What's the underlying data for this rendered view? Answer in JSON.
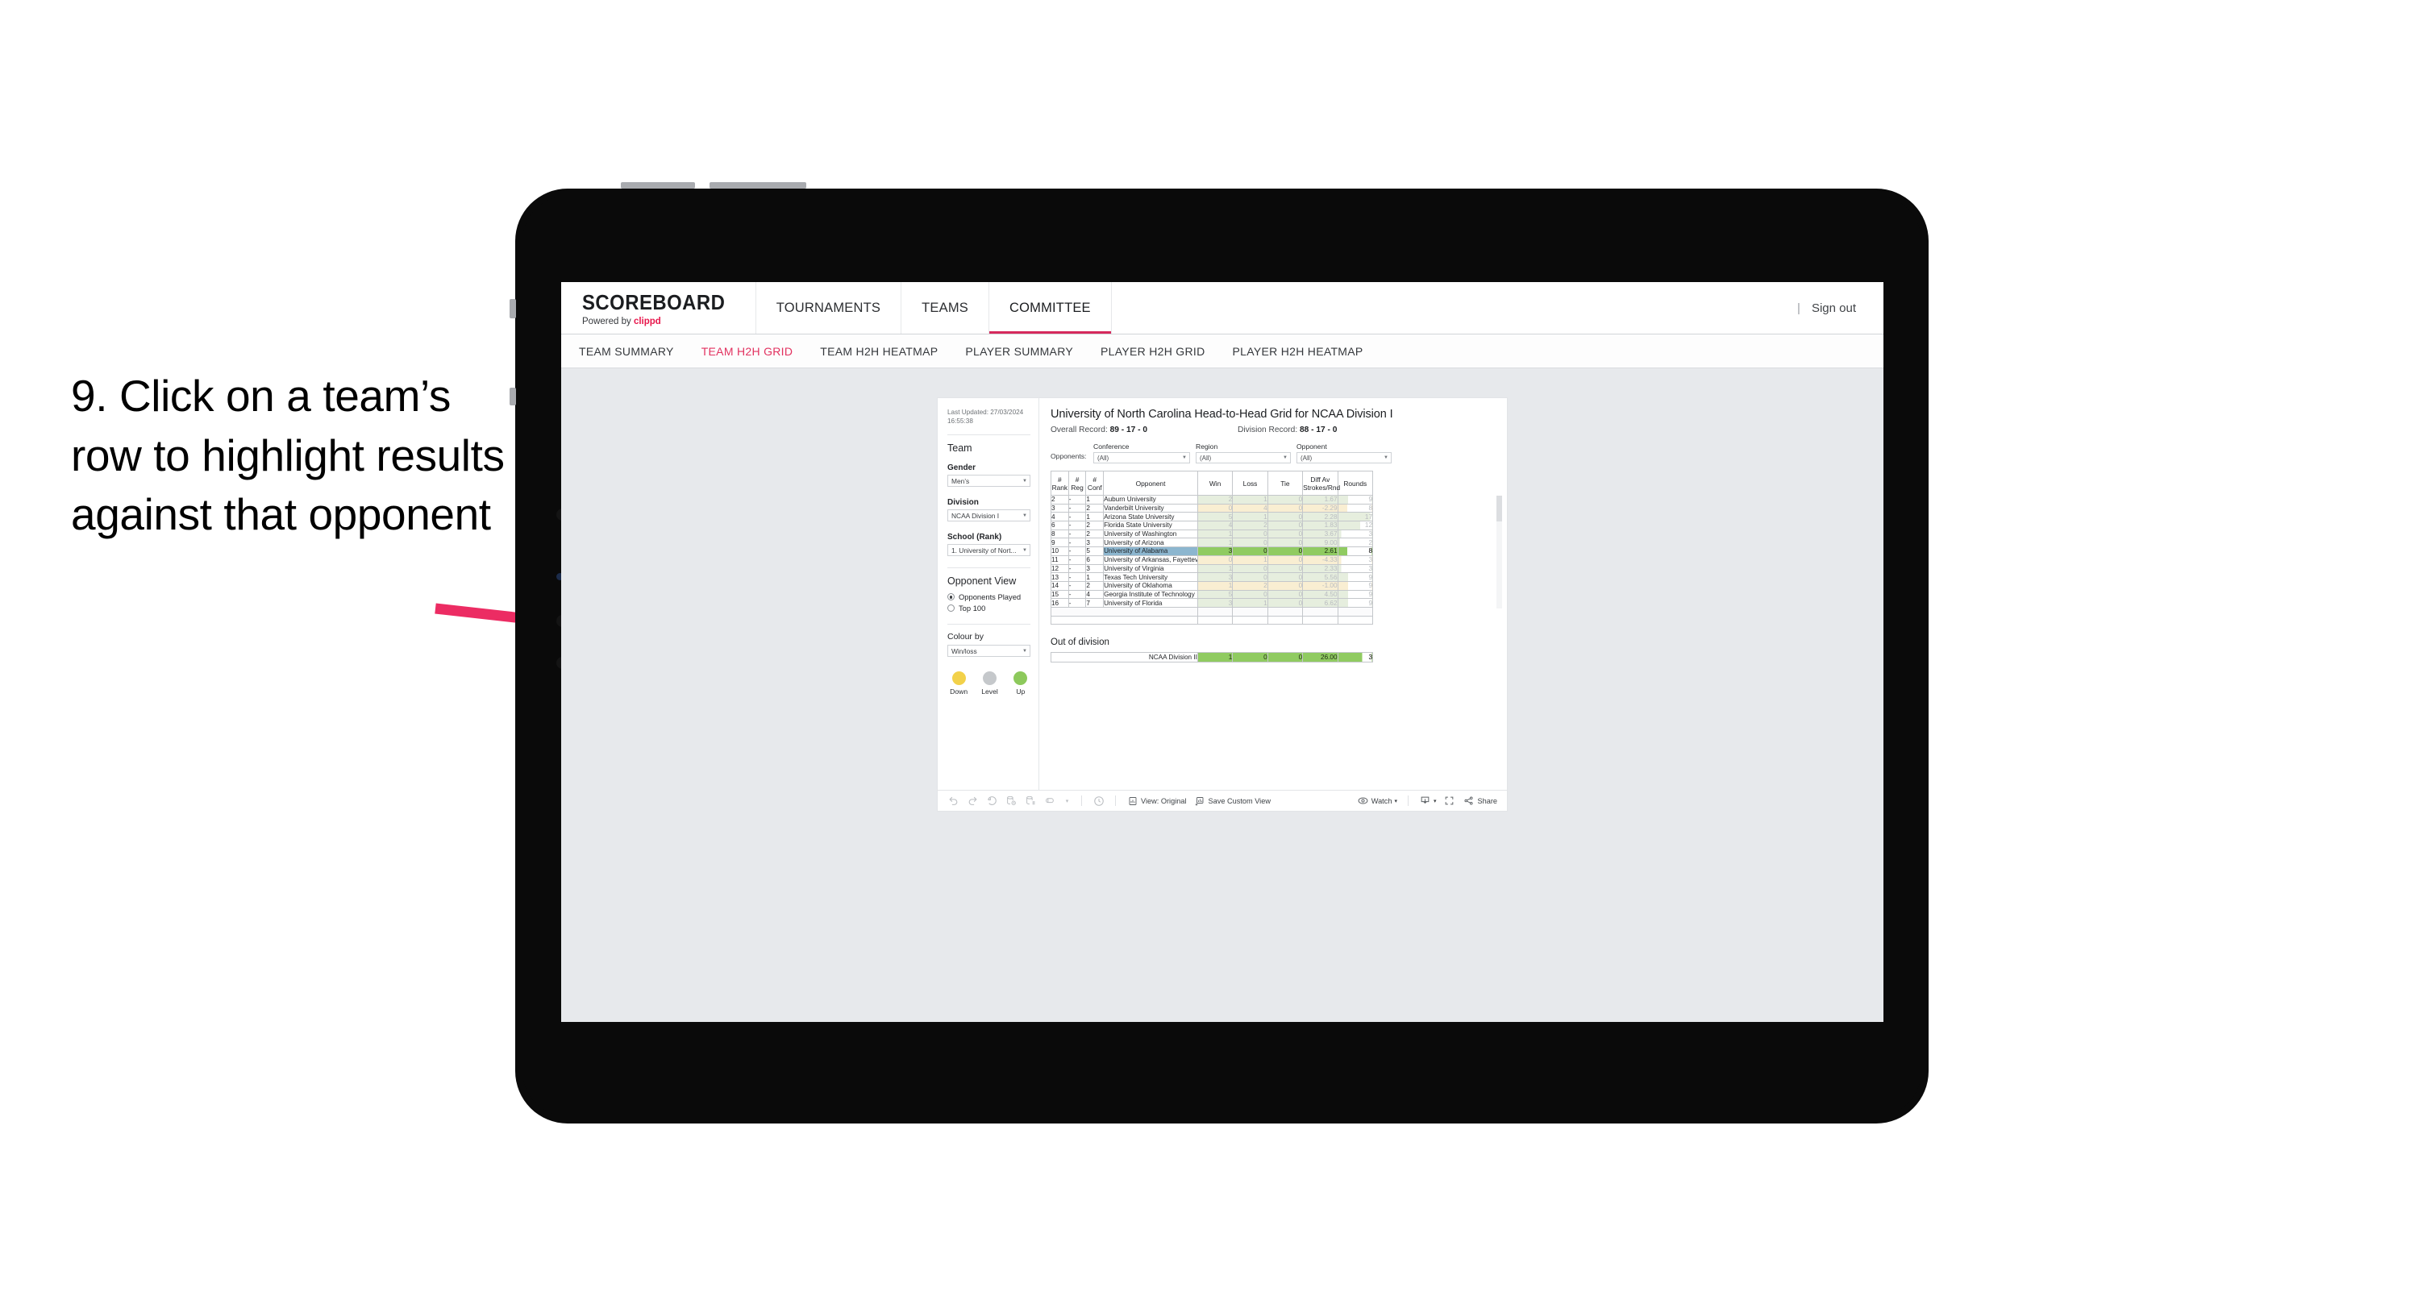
{
  "callout": {
    "text": "9. Click on a team’s row to highlight results against that opponent",
    "arrow_color": "#ec2c63"
  },
  "topnav": {
    "brand_name": "SCOREBOARD",
    "brand_sub_prefix": "Powered by ",
    "brand_sub_accent": "clippd",
    "items": [
      {
        "label": "TOURNAMENTS",
        "active": false
      },
      {
        "label": "TEAMS",
        "active": false
      },
      {
        "label": "COMMITTEE",
        "active": true
      }
    ],
    "divider": "|",
    "signout": "Sign out",
    "accent_color": "#d5295c"
  },
  "subnav": {
    "items": [
      {
        "label": "TEAM SUMMARY",
        "active": false
      },
      {
        "label": "TEAM H2H GRID",
        "active": true
      },
      {
        "label": "TEAM H2H HEATMAP",
        "active": false
      },
      {
        "label": "PLAYER SUMMARY",
        "active": false
      },
      {
        "label": "PLAYER H2H GRID",
        "active": false
      },
      {
        "label": "PLAYER H2H HEATMAP",
        "active": false
      }
    ],
    "active_color": "#e2315f"
  },
  "sidebar": {
    "last_updated": "Last Updated: 27/03/2024 16:55:38",
    "team_heading": "Team",
    "fields": [
      {
        "label": "Gender",
        "value": "Men’s"
      },
      {
        "label": "Division",
        "value": "NCAA Division I"
      },
      {
        "label": "School (Rank)",
        "value": "1. University of Nort..."
      }
    ],
    "opponent_view_heading": "Opponent View",
    "opponent_view_options": [
      {
        "label": "Opponents Played",
        "selected": true
      },
      {
        "label": "Top 100",
        "selected": false
      }
    ],
    "colour_by_label": "Colour by",
    "colour_by_value": "Win/loss",
    "legend": [
      {
        "label": "Down",
        "color": "#f2d14a"
      },
      {
        "label": "Level",
        "color": "#c5c8cb"
      },
      {
        "label": "Up",
        "color": "#8dc95c"
      }
    ]
  },
  "main": {
    "title": "University of North Carolina Head-to-Head Grid for NCAA Division I",
    "overall_record_label": "Overall Record: ",
    "overall_record_value": "89 - 17 - 0",
    "division_record_label": "Division Record: ",
    "division_record_value": "88 - 17 - 0",
    "opponents_label": "Opponents:",
    "filters": [
      {
        "label": "Conference",
        "value": "(All)"
      },
      {
        "label": "Region",
        "value": "(All)"
      },
      {
        "label": "Opponent",
        "value": "(All)"
      }
    ],
    "table": {
      "headers": {
        "rank_l1": "#",
        "rank_l2": "Rank",
        "reg_l1": "#",
        "reg_l2": "Reg",
        "conf_l1": "#",
        "conf_l2": "Conf",
        "opponent": "Opponent",
        "win": "Win",
        "loss": "Loss",
        "tie": "Tie",
        "diff_l1": "Diff Av",
        "diff_l2": "Strokes/Rnd",
        "rounds": "Rounds"
      },
      "rows": [
        {
          "rank": "2",
          "reg": "-",
          "conf": "1",
          "opponent": "Auburn University",
          "win": "2",
          "loss": "1",
          "tie": "0",
          "diff": "1.67",
          "rounds": "9",
          "tone": "g",
          "selected": false,
          "rounds_bar": 0.3
        },
        {
          "rank": "3",
          "reg": "-",
          "conf": "2",
          "opponent": "Vanderbilt University",
          "win": "0",
          "loss": "4",
          "tie": "0",
          "diff": "-2.29",
          "rounds": "8",
          "tone": "y",
          "selected": false,
          "rounds_bar": 0.27
        },
        {
          "rank": "4",
          "reg": "-",
          "conf": "1",
          "opponent": "Arizona State University",
          "win": "5",
          "loss": "1",
          "tie": "0",
          "diff": "2.28",
          "rounds": "17",
          "tone": "g",
          "selected": false,
          "rounds_bar": 0.95
        },
        {
          "rank": "6",
          "reg": "-",
          "conf": "2",
          "opponent": "Florida State University",
          "win": "4",
          "loss": "2",
          "tie": "0",
          "diff": "1.83",
          "rounds": "12",
          "tone": "g",
          "selected": false,
          "rounds_bar": 0.66
        },
        {
          "rank": "8",
          "reg": "-",
          "conf": "2",
          "opponent": "University of Washington",
          "win": "1",
          "loss": "0",
          "tie": "0",
          "diff": "3.67",
          "rounds": "3",
          "tone": "g",
          "selected": false,
          "rounds_bar": 0.1
        },
        {
          "rank": "9",
          "reg": "-",
          "conf": "3",
          "opponent": "University of Arizona",
          "win": "1",
          "loss": "0",
          "tie": "0",
          "diff": "9.00",
          "rounds": "2",
          "tone": "g",
          "selected": false,
          "rounds_bar": 0.06
        },
        {
          "rank": "10",
          "reg": "-",
          "conf": "5",
          "opponent": "University of Alabama",
          "win": "3",
          "loss": "0",
          "tie": "0",
          "diff": "2.61",
          "rounds": "8",
          "tone": "g",
          "selected": true,
          "rounds_bar": 0.27
        },
        {
          "rank": "11",
          "reg": "-",
          "conf": "6",
          "opponent": "University of Arkansas, Fayetteville",
          "win": "0",
          "loss": "1",
          "tie": "0",
          "diff": "-4.33",
          "rounds": "3",
          "tone": "y",
          "selected": false,
          "rounds_bar": 0.1
        },
        {
          "rank": "12",
          "reg": "-",
          "conf": "3",
          "opponent": "University of Virginia",
          "win": "1",
          "loss": "0",
          "tie": "0",
          "diff": "2.33",
          "rounds": "3",
          "tone": "g",
          "selected": false,
          "rounds_bar": 0.1
        },
        {
          "rank": "13",
          "reg": "-",
          "conf": "1",
          "opponent": "Texas Tech University",
          "win": "3",
          "loss": "0",
          "tie": "0",
          "diff": "5.56",
          "rounds": "9",
          "tone": "g",
          "selected": false,
          "rounds_bar": 0.3
        },
        {
          "rank": "14",
          "reg": "-",
          "conf": "2",
          "opponent": "University of Oklahoma",
          "win": "1",
          "loss": "2",
          "tie": "0",
          "diff": "-1.00",
          "rounds": "9",
          "tone": "y",
          "selected": false,
          "rounds_bar": 0.3
        },
        {
          "rank": "15",
          "reg": "-",
          "conf": "4",
          "opponent": "Georgia Institute of Technology",
          "win": "5",
          "loss": "0",
          "tie": "0",
          "diff": "4.50",
          "rounds": "9",
          "tone": "g",
          "selected": false,
          "rounds_bar": 0.3
        },
        {
          "rank": "16",
          "reg": "-",
          "conf": "7",
          "opponent": "University of Florida",
          "win": "3",
          "loss": "1",
          "tie": "0",
          "diff": "6.62",
          "rounds": "9",
          "tone": "g",
          "selected": false,
          "rounds_bar": 0.3
        }
      ]
    },
    "out_of_division": {
      "title": "Out of division",
      "row": {
        "label": "NCAA Division II",
        "win": "1",
        "loss": "0",
        "tie": "0",
        "diff": "26.00",
        "rounds": "3"
      }
    }
  },
  "toolbar": {
    "icons_left": [
      "undo-icon",
      "redo-icon",
      "revert-icon",
      "refresh-data-icon",
      "pause-auto-update-icon",
      "view-original-toggle-icon"
    ],
    "dropdown_caret": "▾",
    "share_view_icon": "share-view-icon",
    "buttons": [
      {
        "label": "View: Original",
        "icon": "view-original-icon"
      },
      {
        "label": "Save Custom View",
        "icon": "save-view-icon"
      }
    ],
    "watch_label": "Watch",
    "download_icon": "download-icon",
    "fullscreen_icon": "fullscreen-icon",
    "share_label": "Share"
  },
  "chart_data": {
    "type": "table",
    "title": "University of North Carolina Head-to-Head Grid for NCAA Division I",
    "columns": [
      "# Rank",
      "# Reg",
      "# Conf",
      "Opponent",
      "Win",
      "Loss",
      "Tie",
      "Diff Av Strokes/Rnd",
      "Rounds"
    ],
    "rows": [
      [
        "2",
        "-",
        "1",
        "Auburn University",
        2,
        1,
        0,
        1.67,
        9
      ],
      [
        "3",
        "-",
        "2",
        "Vanderbilt University",
        0,
        4,
        0,
        -2.29,
        8
      ],
      [
        "4",
        "-",
        "1",
        "Arizona State University",
        5,
        1,
        0,
        2.28,
        17
      ],
      [
        "6",
        "-",
        "2",
        "Florida State University",
        4,
        2,
        0,
        1.83,
        12
      ],
      [
        "8",
        "-",
        "2",
        "University of Washington",
        1,
        0,
        0,
        3.67,
        3
      ],
      [
        "9",
        "-",
        "3",
        "University of Arizona",
        1,
        0,
        0,
        9.0,
        2
      ],
      [
        "10",
        "-",
        "5",
        "University of Alabama",
        3,
        0,
        0,
        2.61,
        8
      ],
      [
        "11",
        "-",
        "6",
        "University of Arkansas, Fayetteville",
        0,
        1,
        0,
        -4.33,
        3
      ],
      [
        "12",
        "-",
        "3",
        "University of Virginia",
        1,
        0,
        0,
        2.33,
        3
      ],
      [
        "13",
        "-",
        "1",
        "Texas Tech University",
        3,
        0,
        0,
        5.56,
        9
      ],
      [
        "14",
        "-",
        "2",
        "University of Oklahoma",
        1,
        2,
        0,
        -1.0,
        9
      ],
      [
        "15",
        "-",
        "4",
        "Georgia Institute of Technology",
        5,
        0,
        0,
        4.5,
        9
      ],
      [
        "16",
        "-",
        "7",
        "University of Florida",
        3,
        1,
        0,
        6.62,
        9
      ]
    ],
    "out_of_division": [
      [
        "NCAA Division II",
        1,
        0,
        0,
        26.0,
        3
      ]
    ],
    "selected_row": "University of Alabama",
    "legend": [
      {
        "label": "Down",
        "color": "#f2d14a"
      },
      {
        "label": "Level",
        "color": "#c5c8cb"
      },
      {
        "label": "Up",
        "color": "#8dc95c"
      }
    ]
  }
}
